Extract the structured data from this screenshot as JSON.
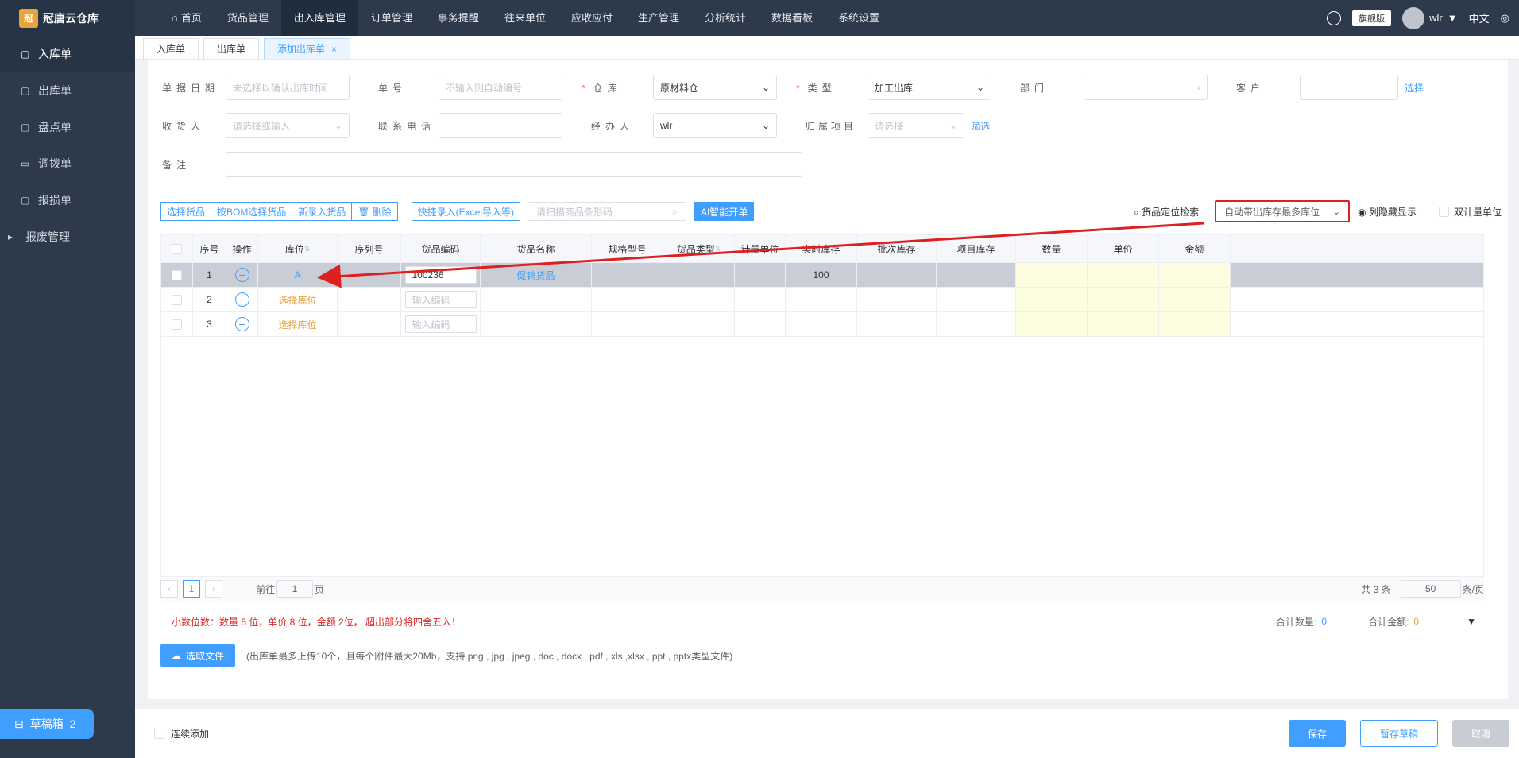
{
  "app": {
    "name": "冠唐云仓库",
    "logo_text": "冠"
  },
  "nav": [
    {
      "label": "首页",
      "icon": "home-icon"
    },
    {
      "label": "货品管理"
    },
    {
      "label": "出入库管理",
      "active": true
    },
    {
      "label": "订单管理"
    },
    {
      "label": "事务提醒"
    },
    {
      "label": "往来单位"
    },
    {
      "label": "应收应付"
    },
    {
      "label": "生产管理"
    },
    {
      "label": "分析统计"
    },
    {
      "label": "数据看板"
    },
    {
      "label": "系统设置"
    }
  ],
  "topright": {
    "edition": "旗舰版",
    "user": "wlr",
    "lang": "中文"
  },
  "sidebar": [
    {
      "label": "入库单",
      "active": true
    },
    {
      "label": "出库单"
    },
    {
      "label": "盘点单"
    },
    {
      "label": "调拨单"
    },
    {
      "label": "报损单"
    },
    {
      "label": "报废管理"
    }
  ],
  "draft": {
    "label": "草稿箱",
    "count": "2"
  },
  "tabs": [
    {
      "label": "入库单"
    },
    {
      "label": "出库单"
    },
    {
      "label": "添加出库单",
      "active": true
    }
  ],
  "form": {
    "date_label": "单据日期",
    "date_placeholder": "未选择以确认出库时间",
    "no_label": "单号",
    "no_placeholder": "不输入则自动编号",
    "warehouse_label": "仓库",
    "warehouse_value": "原材料仓",
    "type_label": "类型",
    "type_value": "加工出库",
    "dept_label": "部门",
    "customer_label": "客户",
    "customer_link": "选择",
    "receiver_label": "收货人",
    "receiver_placeholder": "请选择或输入",
    "phone_label": "联系电话",
    "handler_label": "经办人",
    "handler_value": "wlr",
    "project_label": "归属项目",
    "project_placeholder": "请选择",
    "project_link": "筛选",
    "remark_label": "备注"
  },
  "toolbar": {
    "select_goods": "选择货品",
    "bom_select": "按BOM选择货品",
    "new_goods": "新录入货品",
    "delete": "删除",
    "quick_entry": "快捷录入(Excel导入等)",
    "scan_placeholder": "请扫描商品条形码",
    "ai": "AI智能开单",
    "locate": "货品定位检索",
    "auto_select": "自动带出库存最多库位",
    "toggle_columns": "列隐藏显示",
    "dual_unit": "双计量单位"
  },
  "table": {
    "headers": [
      "序号",
      "操作",
      "库位",
      "序列号",
      "货品编码",
      "货品名称",
      "规格型号",
      "货品类型",
      "计量单位",
      "实时库存",
      "批次库存",
      "项目库存",
      "数量",
      "单价",
      "金额"
    ],
    "rows": [
      {
        "no": "1",
        "location": "A",
        "code": "100236",
        "name": "促销货品",
        "stock": "100"
      },
      {
        "no": "2",
        "location": "选择库位",
        "code_placeholder": "输入编码"
      },
      {
        "no": "3",
        "location": "选择库位",
        "code_placeholder": "输入编码"
      }
    ]
  },
  "pager": {
    "page": "1",
    "goto_prefix": "前往",
    "goto_value": "1",
    "goto_suffix": "页",
    "total": "共 3 条",
    "page_size": "50",
    "page_size_suffix": "条/页"
  },
  "summary": {
    "warning": "小数位数：数量 5 位，单价 8 位，金额 2位， 超出部分将四舍五入！",
    "qty_label": "合计数量:",
    "qty_value": "0",
    "amount_label": "合计金额:",
    "amount_value": "0"
  },
  "upload": {
    "button": "选取文件",
    "hint": "(出库单最多上传10个，且每个附件最大20Mb，支持 png , jpg , jpeg , doc , docx , pdf , xls ,xlsx , ppt , pptx类型文件)"
  },
  "footer": {
    "continuous": "连续添加",
    "save": "保存",
    "draft": "暂存草稿",
    "cancel": "取消"
  },
  "colors": {
    "primary": "#409eff",
    "nav_bg": "#2d3a4b",
    "warn": "#e02020",
    "orange": "#e6a23c"
  }
}
